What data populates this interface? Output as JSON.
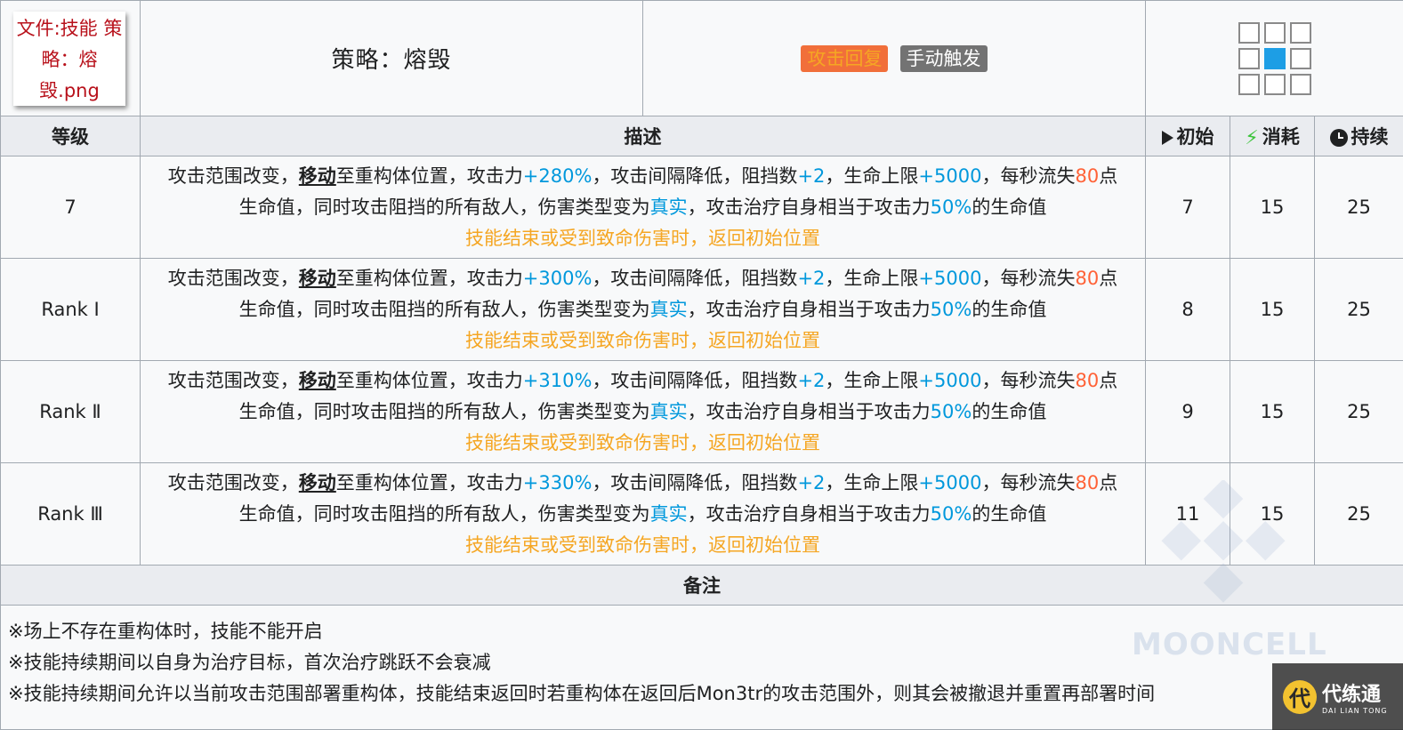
{
  "header": {
    "file_label": "文件:技能 策略：熔毁.png",
    "skill_name": "策略：熔毁",
    "badges": [
      {
        "label": "攻击回复",
        "color": "#f16f3a"
      },
      {
        "label": "手动触发",
        "color": "#737373"
      }
    ],
    "range_grid": [
      0,
      0,
      0,
      0,
      1,
      0,
      0,
      0,
      0
    ]
  },
  "columns": {
    "level": "等级",
    "desc": "描述",
    "initial": "初始",
    "cost": "消耗",
    "duration": "持续"
  },
  "rows": [
    {
      "level": "7",
      "atk": "+280%",
      "initial": "7",
      "cost": "15",
      "duration": "25"
    },
    {
      "level": "Rank Ⅰ",
      "atk": "+300%",
      "initial": "8",
      "cost": "15",
      "duration": "25"
    },
    {
      "level": "Rank Ⅱ",
      "atk": "+310%",
      "initial": "9",
      "cost": "15",
      "duration": "25"
    },
    {
      "level": "Rank Ⅲ",
      "atk": "+330%",
      "initial": "11",
      "cost": "15",
      "duration": "25"
    }
  ],
  "desc_parts": {
    "p1": "攻击范围改变，",
    "move": "移动",
    "p2": "至重构体位置，攻击力",
    "p3": "，攻击间隔降低，阻挡数",
    "block": "+2",
    "p4": "，生命上限",
    "hp": "+5000",
    "p5": "，每秒流失",
    "loss": "80",
    "p6": "点",
    "p7": "生命值，同时攻击阻挡的所有敌人，伤害类型变为",
    "true_dmg": "真实",
    "p8": "，攻击治疗自身相当于攻击力",
    "heal": "50%",
    "p9": "的生命值",
    "end_note": "技能结束或受到致命伤害时，返回初始位置"
  },
  "notes": {
    "title": "备注",
    "lines": [
      "※场上不存在重构体时，技能不能开启",
      "※技能持续期间以自身为治疗目标，首次治疗跳跃不会衰减",
      "※技能持续期间允许以当前攻击范围部署重构体，技能结束返回时若重构体在返回后Mon3tr的攻击范围外，则其会被撤退并重置再部署时间"
    ]
  },
  "watermark": {
    "text": "MOONCELL"
  },
  "logo": {
    "cn": "代练通",
    "en": "DAI LIAN TONG",
    "icon": "代"
  }
}
